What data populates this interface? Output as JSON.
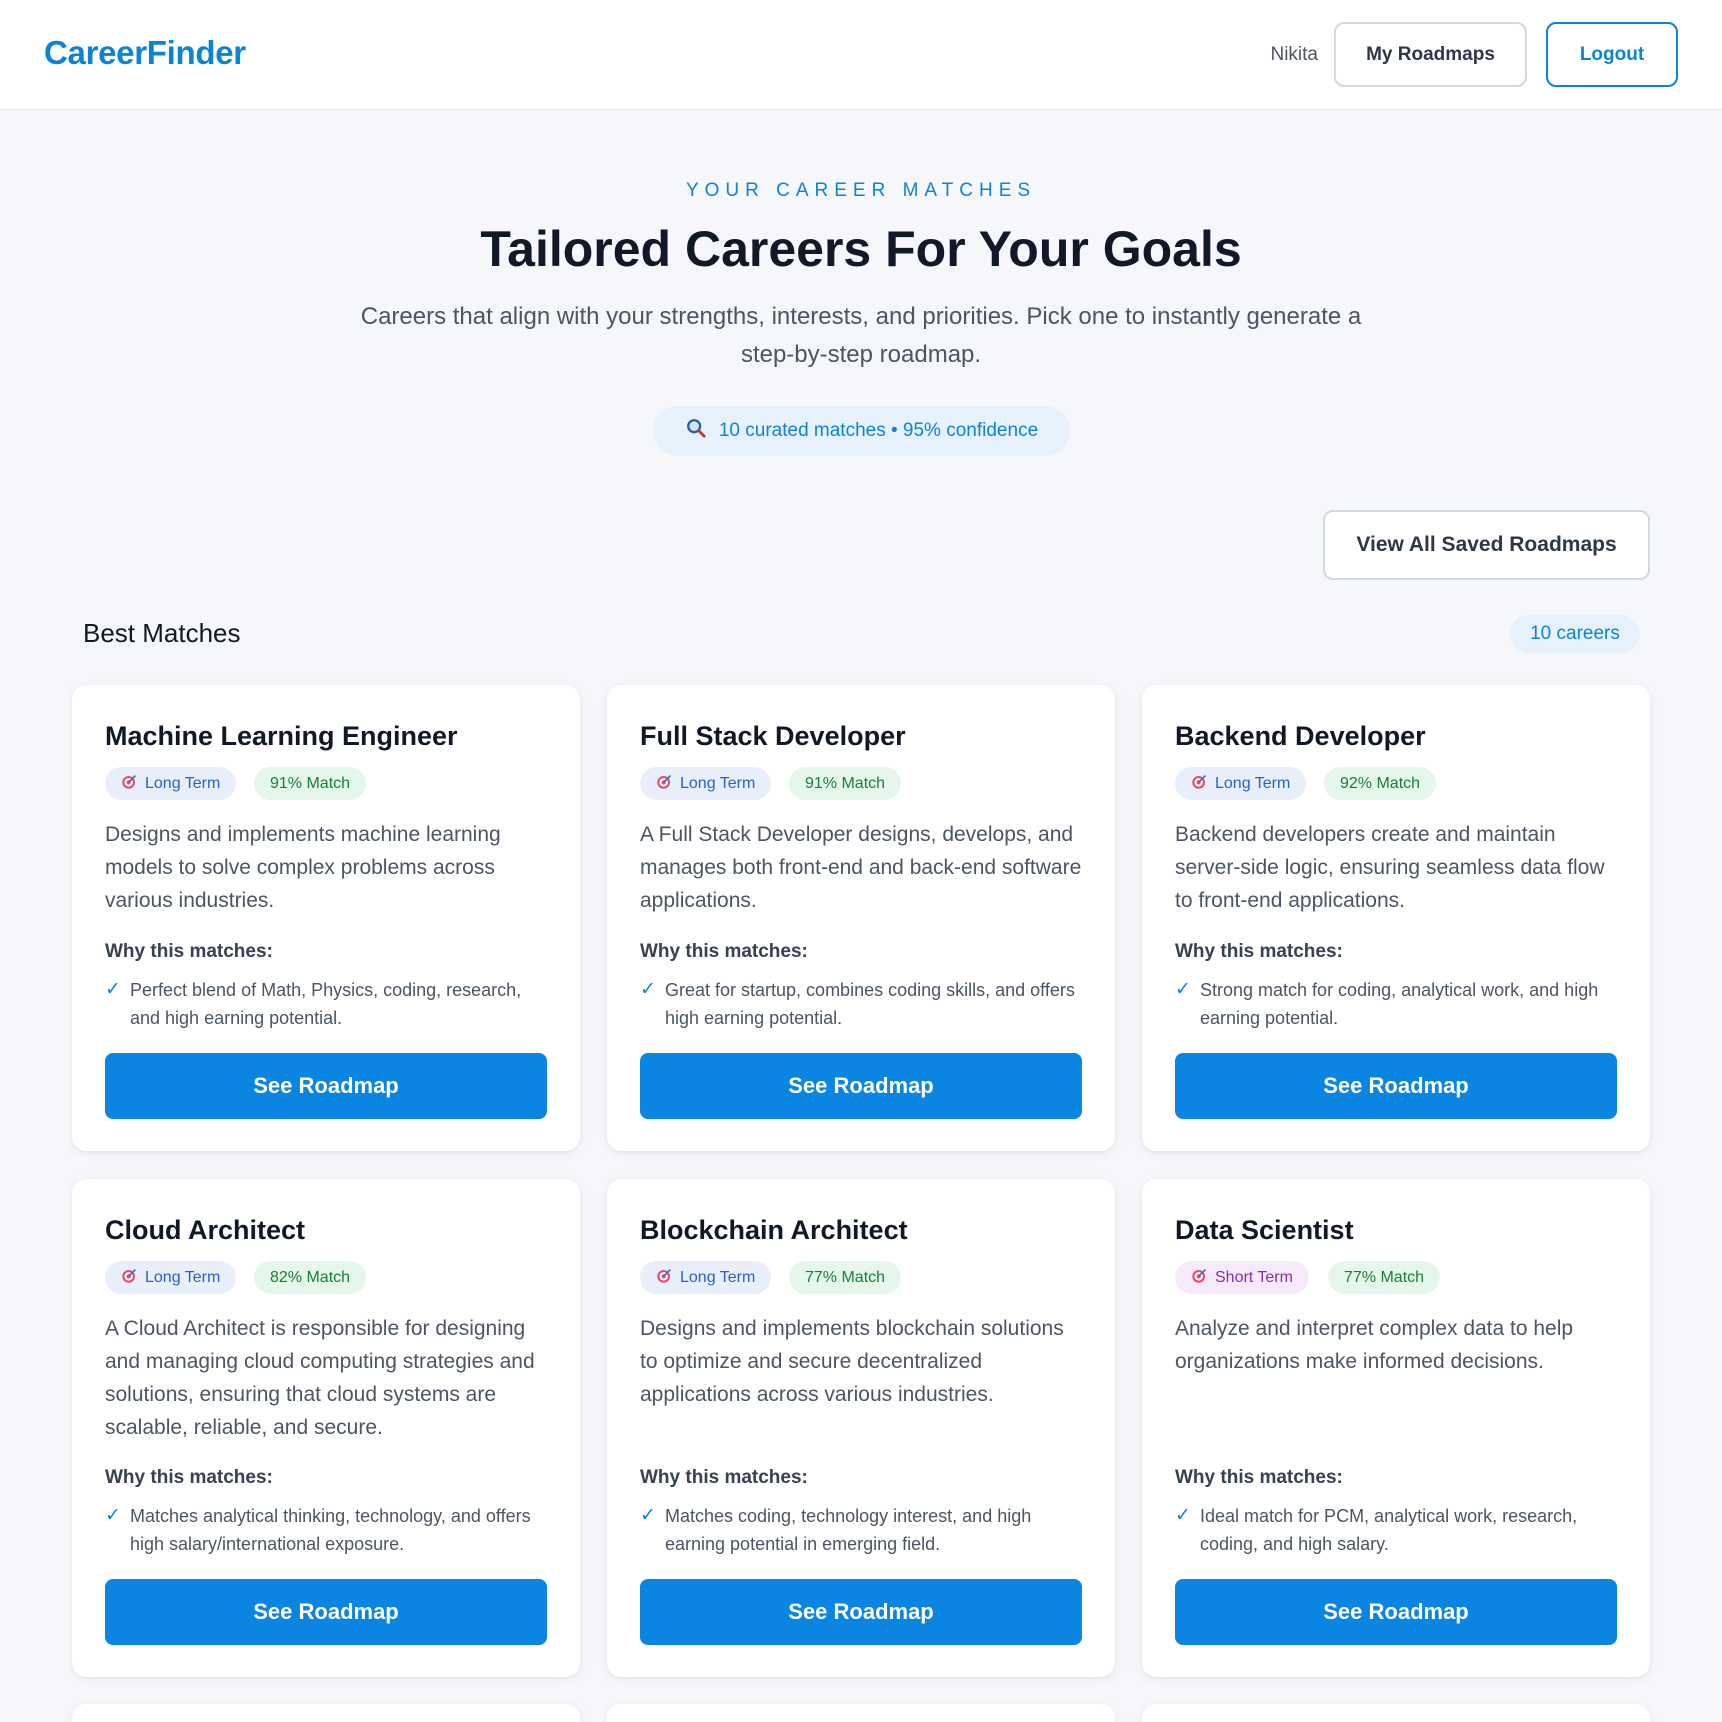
{
  "header": {
    "brand": "CareerFinder",
    "user_name": "Nikita",
    "my_roadmaps_label": "My Roadmaps",
    "logout_label": "Logout"
  },
  "hero": {
    "eyebrow": "YOUR CAREER MATCHES",
    "title": "Tailored Careers For Your Goals",
    "subtitle": "Careers that align with your strengths, interests, and priorities. Pick one to instantly generate a step-by-step roadmap.",
    "summary": "10 curated matches • 95% confidence",
    "summary_icon": "search-icon"
  },
  "actions": {
    "view_saved_label": "View All Saved Roadmaps"
  },
  "section": {
    "title": "Best Matches",
    "count_label": "10 careers"
  },
  "labels": {
    "why_heading": "Why this matches:",
    "cta": "See Roadmap",
    "term_icon": "target-icon",
    "check_icon": "check-icon"
  },
  "colors": {
    "accent": "#0b84d6",
    "button": "#0a85e2",
    "match_bg": "#e4f7ea",
    "match_text": "#18803a",
    "long_term_bg": "#e8effa",
    "short_term_bg": "#f6eafa"
  },
  "cards": [
    {
      "title": "Machine Learning Engineer",
      "term": "Long Term",
      "match": "91% Match",
      "description": "Designs and implements machine learning models to solve complex problems across various industries.",
      "reason": "Perfect blend of Math, Physics, coding, research, and high earning potential."
    },
    {
      "title": "Full Stack Developer",
      "term": "Long Term",
      "match": "91% Match",
      "description": "A Full Stack Developer designs, develops, and manages both front-end and back-end software applications.",
      "reason": "Great for startup, combines coding skills, and offers high earning potential."
    },
    {
      "title": "Backend Developer",
      "term": "Long Term",
      "match": "92% Match",
      "description": "Backend developers create and maintain server-side logic, ensuring seamless data flow to front-end applications.",
      "reason": "Strong match for coding, analytical work, and high earning potential."
    },
    {
      "title": "Cloud Architect",
      "term": "Long Term",
      "match": "82% Match",
      "description": "A Cloud Architect is responsible for designing and managing cloud computing strategies and solutions, ensuring that cloud systems are scalable, reliable, and secure.",
      "reason": "Matches analytical thinking, technology, and offers high salary/international exposure."
    },
    {
      "title": "Blockchain Architect",
      "term": "Long Term",
      "match": "77% Match",
      "description": "Designs and implements blockchain solutions to optimize and secure decentralized applications across various industries.",
      "reason": "Matches coding, technology interest, and high earning potential in emerging field."
    },
    {
      "title": "Data Scientist",
      "term": "Short Term",
      "match": "77% Match",
      "description": "Analyze and interpret complex data to help organizations make informed decisions.",
      "reason": "Ideal match for PCM, analytical work, research, coding, and high salary."
    }
  ]
}
